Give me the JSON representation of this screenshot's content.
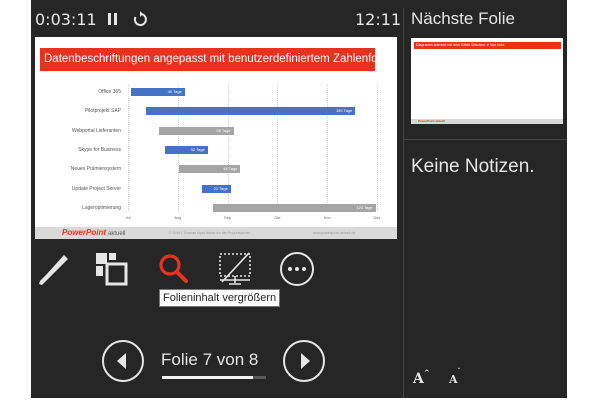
{
  "top_bar": {
    "elapsed_time": "0:03:11",
    "clock": "12:11",
    "next_slide_heading": "Nächste Folie"
  },
  "slide": {
    "title": "Datenbeschriftungen angepasst mit benutzerdefiniertem Zahlenformat",
    "footer_logo_brand": "PowerPoint",
    "footer_logo_suffix": "aktuell",
    "footer_center": "© 2016 | Thomas Ikpot dichte für die Projekt­sachen",
    "footer_right": "www.powerpoint-aktuell.de"
  },
  "chart_data": {
    "type": "bar",
    "categories": [
      "Office 365",
      "Pilotprojekt SAP",
      "Webportal Lieferanten",
      "Skype for Business",
      "Neues Prämiensystem",
      "Update Project Server",
      "Lageroptimierung"
    ],
    "x_ticks": [
      "Jul",
      "Aug",
      "Sep",
      "Okt",
      "Nov",
      "Dez"
    ],
    "series": [
      {
        "values": [
          40,
          155,
          55,
          32,
          45,
          21,
          120
        ],
        "labels": [
          "40 Tage",
          "155 Tage",
          "55 Tage",
          "32 Tage",
          "45 Tage",
          "21 Tage",
          "120 Tage"
        ],
        "colors": [
          "#4472c4",
          "#4472c4",
          "#a5a5a5",
          "#4472c4",
          "#a5a5a5",
          "#4472c4",
          "#a5a5a5"
        ]
      }
    ],
    "start_offset_days": [
      2,
      13,
      23,
      27,
      38,
      55,
      63
    ],
    "xlim_days": [
      0,
      184
    ]
  },
  "tools": {
    "tooltip_zoom": "Folieninhalt vergrößern"
  },
  "navigation": {
    "slide_counter": "Folie 7 von 8",
    "progress": 0.875
  },
  "next_slide": {
    "title": "Diagramm animiert mit dem Effekt Wischen ➜ Von links",
    "footer_logo": "PowerPoint aktuell"
  },
  "notes": {
    "text": "Keine Notizen."
  },
  "font_controls": {
    "increase": "A",
    "decrease": "A"
  },
  "colors": {
    "background": "#262626",
    "accent_red": "#e8321e",
    "bar_blue": "#4472c4",
    "bar_gray": "#a5a5a5"
  }
}
